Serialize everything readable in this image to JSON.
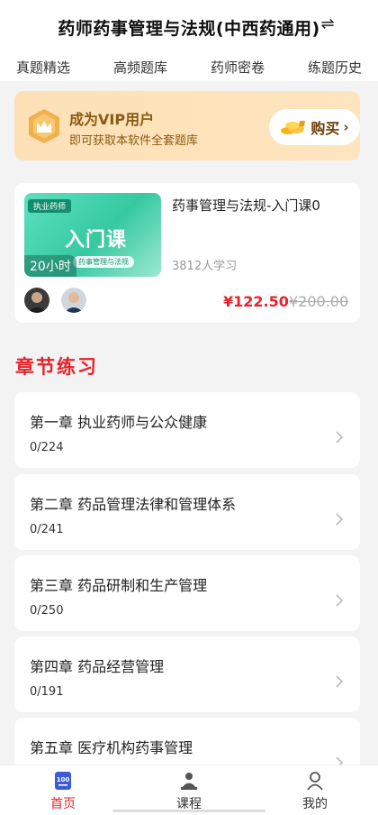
{
  "header": {
    "title": "药师药事管理与法规(中西药通用)",
    "switch_icon": "⇌"
  },
  "tabs": [
    {
      "label": "真题精选"
    },
    {
      "label": "高频题库"
    },
    {
      "label": "药师密卷"
    },
    {
      "label": "练题历史"
    }
  ],
  "vip": {
    "title": "成为VIP用户",
    "subtitle": "即可获取本软件全套题库",
    "buy_label": "购买",
    "buy_arrow": "›"
  },
  "course": {
    "thumb_tag": "执业药师",
    "thumb_title": "入门课",
    "thumb_pill": "药事管理与法规",
    "thumb_hours": "20小时",
    "title": "药事管理与法规-入门课0",
    "learners": "3812人学习",
    "price": "¥122.50",
    "original_price": "¥200.00"
  },
  "section": {
    "title": "章节练习"
  },
  "chapters": [
    {
      "title": "第一章  执业药师与公众健康",
      "count": "0/224"
    },
    {
      "title": "第二章  药品管理法律和管理体系",
      "count": "0/241"
    },
    {
      "title": "第三章  药品研制和生产管理",
      "count": "0/250"
    },
    {
      "title": "第四章  药品经营管理",
      "count": "0/191"
    },
    {
      "title": "第五章  医疗机构药事管理",
      "count": ""
    }
  ],
  "bottom_nav": [
    {
      "label": "首页",
      "icon": "home-100-icon",
      "active": true
    },
    {
      "label": "课程",
      "icon": "teacher-icon",
      "active": false
    },
    {
      "label": "我的",
      "icon": "user-icon",
      "active": false
    }
  ],
  "colors": {
    "accent": "#e5232a",
    "vip_bg": "#fde0b6",
    "vip_text": "#8a5a12",
    "active_nav": "#3b5bdb"
  }
}
